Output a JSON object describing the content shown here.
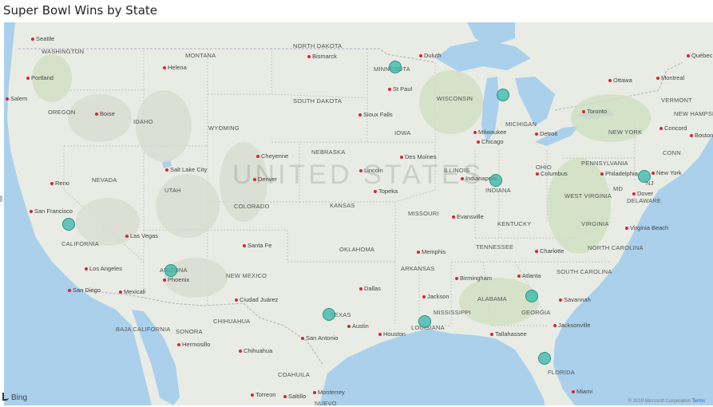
{
  "title": "Super Bowl Wins by State",
  "watermark": "UNITED STATES",
  "attribution": {
    "brand": "Bing",
    "copyright": "© 2019 Microsoft Corporation",
    "terms": "Terms"
  },
  "states": [
    {
      "name": "WASHINGTON"
    },
    {
      "name": "OREGON"
    },
    {
      "name": "IDAHO"
    },
    {
      "name": "MONTANA"
    },
    {
      "name": "WYOMING"
    },
    {
      "name": "NORTH DAKOTA"
    },
    {
      "name": "SOUTH DAKOTA"
    },
    {
      "name": "MINNESOTA"
    },
    {
      "name": "WISCONSIN"
    },
    {
      "name": "MICHIGAN"
    },
    {
      "name": "NEVADA"
    },
    {
      "name": "UTAH"
    },
    {
      "name": "COLORADO"
    },
    {
      "name": "NEBRASKA"
    },
    {
      "name": "IOWA"
    },
    {
      "name": "ILLINOIS"
    },
    {
      "name": "INDIANA"
    },
    {
      "name": "OHIO"
    },
    {
      "name": "PENNSYLVANIA"
    },
    {
      "name": "NEW YORK"
    },
    {
      "name": "CALIFORNIA"
    },
    {
      "name": "ARIZONA"
    },
    {
      "name": "NEW MEXICO"
    },
    {
      "name": "KANSAS"
    },
    {
      "name": "MISSOURI"
    },
    {
      "name": "KENTUCKY"
    },
    {
      "name": "WEST VIRGINIA"
    },
    {
      "name": "VIRGINIA"
    },
    {
      "name": "OKLAHOMA"
    },
    {
      "name": "ARKANSAS"
    },
    {
      "name": "TENNESSEE"
    },
    {
      "name": "NORTH CAROLINA"
    },
    {
      "name": "SOUTH CAROLINA"
    },
    {
      "name": "TEXAS"
    },
    {
      "name": "LOUISIANA"
    },
    {
      "name": "MISSISSIPPI"
    },
    {
      "name": "ALABAMA"
    },
    {
      "name": "GEORGIA"
    },
    {
      "name": "FLORIDA"
    },
    {
      "name": "VERMONT"
    },
    {
      "name": "NEW HAMPSHIRE"
    },
    {
      "name": "CONN"
    },
    {
      "name": "NJ"
    },
    {
      "name": "MD"
    },
    {
      "name": "DELAWARE"
    },
    {
      "name": "BAJA CALIFORNIA"
    },
    {
      "name": "SONORA"
    },
    {
      "name": "CHIHUAHUA"
    },
    {
      "name": "COAHUILA"
    },
    {
      "name": "NUEVO"
    }
  ],
  "cities": [
    {
      "name": "Seattle"
    },
    {
      "name": "Portland"
    },
    {
      "name": "Salem"
    },
    {
      "name": "Helena"
    },
    {
      "name": "Boise"
    },
    {
      "name": "Bismarck"
    },
    {
      "name": "Duluth"
    },
    {
      "name": "St Paul"
    },
    {
      "name": "Sioux Falls"
    },
    {
      "name": "Ottawa"
    },
    {
      "name": "Montreal"
    },
    {
      "name": "Québec"
    },
    {
      "name": "Toronto"
    },
    {
      "name": "Milwaukee"
    },
    {
      "name": "Chicago"
    },
    {
      "name": "Detroit"
    },
    {
      "name": "Cheyenne"
    },
    {
      "name": "Salt Lake City"
    },
    {
      "name": "Denver"
    },
    {
      "name": "Lincoln"
    },
    {
      "name": "Des Moines"
    },
    {
      "name": "Topeka"
    },
    {
      "name": "Indianapolis"
    },
    {
      "name": "Columbus"
    },
    {
      "name": "Philadelphia"
    },
    {
      "name": "New York"
    },
    {
      "name": "Concord"
    },
    {
      "name": "Boston"
    },
    {
      "name": "Dover"
    },
    {
      "name": "Reno"
    },
    {
      "name": "San Francisco"
    },
    {
      "name": "Las Vegas"
    },
    {
      "name": "Los Angeles"
    },
    {
      "name": "San Diego"
    },
    {
      "name": "Mexicali"
    },
    {
      "name": "Phoenix"
    },
    {
      "name": "Santa Fe"
    },
    {
      "name": "Ciudad Juárez"
    },
    {
      "name": "Evansville"
    },
    {
      "name": "Memphis"
    },
    {
      "name": "Dallas"
    },
    {
      "name": "Austin"
    },
    {
      "name": "San Antonio"
    },
    {
      "name": "Houston"
    },
    {
      "name": "Jackson"
    },
    {
      "name": "Birmingham"
    },
    {
      "name": "Atlanta"
    },
    {
      "name": "Charlotte"
    },
    {
      "name": "Virginia Beach"
    },
    {
      "name": "Savannah"
    },
    {
      "name": "Tallahassee"
    },
    {
      "name": "Jacksonville"
    },
    {
      "name": "Miami"
    },
    {
      "name": "Hermosillo"
    },
    {
      "name": "Chihuahua"
    },
    {
      "name": "Torreon"
    },
    {
      "name": "Saltillo"
    },
    {
      "name": "Monterrey"
    }
  ],
  "bubbles": [
    {
      "state": "MINNESOTA"
    },
    {
      "state": "MICHIGAN"
    },
    {
      "state": "INDIANA"
    },
    {
      "state": "NJ"
    },
    {
      "state": "CALIFORNIA"
    },
    {
      "state": "ARIZONA"
    },
    {
      "state": "TEXAS"
    },
    {
      "state": "LOUISIANA"
    },
    {
      "state": "GEORGIA"
    },
    {
      "state": "FLORIDA"
    }
  ],
  "colors": {
    "land": "#e9ece4",
    "water": "#aad0ec",
    "bubble": "#34b7aa",
    "city_dot": "#dd2233"
  }
}
